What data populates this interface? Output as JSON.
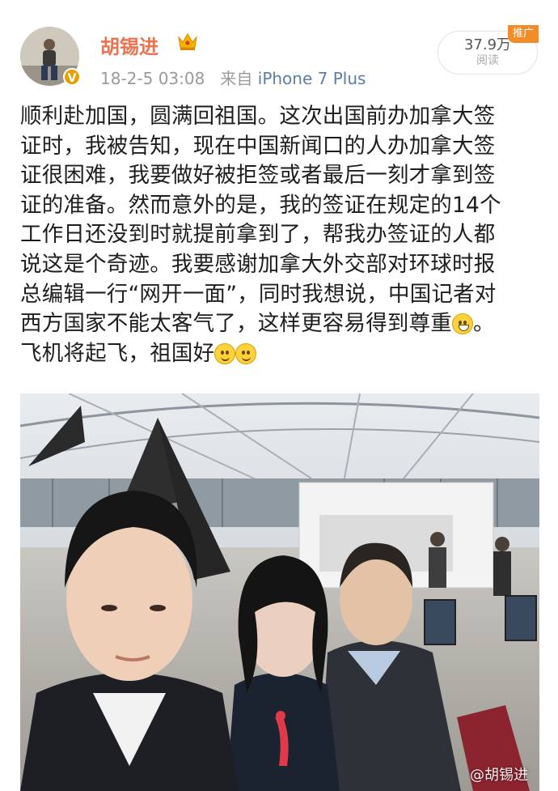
{
  "post": {
    "username": "胡锡进",
    "timestamp": "18-2-5 03:08",
    "source_prefix": "来自",
    "source_device": "iPhone 7 Plus",
    "read_count": "37.9万",
    "read_label": "阅读",
    "promo_badge": "推广",
    "text_lines": [
      "顺利赴加国，圆满回祖国。这次出国前办加拿大签",
      "证时，我被告知，现在中国新闻口的人办加拿大签",
      "证很困难，我要做好被拒签或者最后一刻才拿到签",
      "证的准备。然而意外的是，我的签证在规定的14个",
      "工作日还没到时就提前拿到了，帮我办签证的人都",
      "说这是个奇迹。我要感谢加拿大外交部对环球时报",
      "总编辑一行“网开一面”，同时我想说，中国记者对",
      "西方国家不能太客气了，这样更容易得到尊重",
      "。",
      "飞机将起飞，祖国好"
    ],
    "watermark": "@胡锡进"
  },
  "icons": {
    "verified": "verified-v-icon",
    "crown": "vip-crown-icon",
    "emoji_grin": "grin-emoji-icon",
    "emoji_smile": "smile-emoji-icon"
  },
  "colors": {
    "username": "#eb7350",
    "source_link": "#5b7ea7",
    "promo": "#f28c28",
    "verified": "#e8a000"
  }
}
